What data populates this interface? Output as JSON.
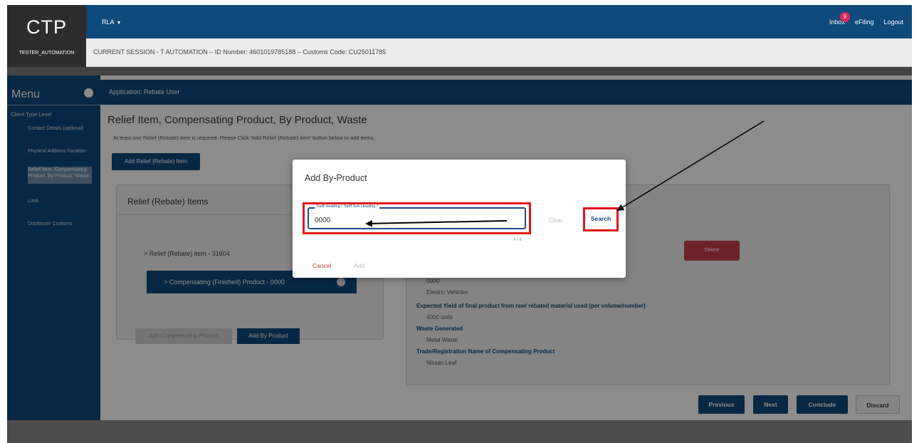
{
  "header": {
    "logo": "CTP",
    "user": "TESTER_AUTOMATION",
    "menu_label": "RLA",
    "inbox_label": "Inbox",
    "inbox_count": "9",
    "efiling_label": "eFiling",
    "logout_label": "Logout",
    "session_text": "CURRENT SESSION - T AUTOMATION – ID Number: 4601019785188 – Customs Code: CU25011785"
  },
  "sidebar": {
    "title": "Menu",
    "section": "Client Type Level",
    "items": [
      {
        "label": "Contact Details (optional)"
      },
      {
        "label": "Physical Address /location"
      },
      {
        "label": "Relief Item, Compensating Product, By Product, Waste"
      }
    ],
    "limit": "Limit",
    "disclosure": "Disclosure Customs"
  },
  "app": {
    "title": "Application: Rebate User"
  },
  "main": {
    "title": "Relief Item, Compensating Product, By Product, Waste",
    "subtitle": "At least one Relief (Rebate) item is required. Please Click 'Add Relief (Rebate) item' button below to add items.",
    "add_relief_btn": "Add Relief (Rebate) Item",
    "left_card_title": "Relief (Rebate) Items",
    "relief_item": "> Relief (Rebate) item - 31604",
    "comp_item": "> Compensating (Finished) Product - 0000",
    "add_comp_btn": "Add Compensating Product",
    "add_byp_btn": "Add By Product",
    "delete_btn": "Delete",
    "details": {
      "tariff_value": "0000:",
      "tariff_desc": "Electric Vehicles",
      "yield_label": "Expected Yield of final product from raw/ rebated material used (per volume/number)",
      "yield_value": "4000 units",
      "waste_label": "Waste Generated",
      "waste_value": "Metal Waste",
      "trade_label": "Trade/Registration Name of Compensating Product",
      "trade_value": "Nissan Leaf"
    },
    "footer": {
      "previous": "Previous",
      "next": "Next",
      "conclude": "Conclude",
      "discard": "Discard"
    }
  },
  "modal": {
    "title": "Add By-Product",
    "field_label": "Tariff Heading / Tariff Sub Heading *",
    "field_value": "0000",
    "counter": "4 / 8",
    "clear": "Clear",
    "search": "Search",
    "cancel": "Cancel",
    "add": "Add"
  },
  "colors": {
    "brand": "#0e4a7c",
    "highlight": "#e0141b",
    "danger": "#c93f4f"
  }
}
